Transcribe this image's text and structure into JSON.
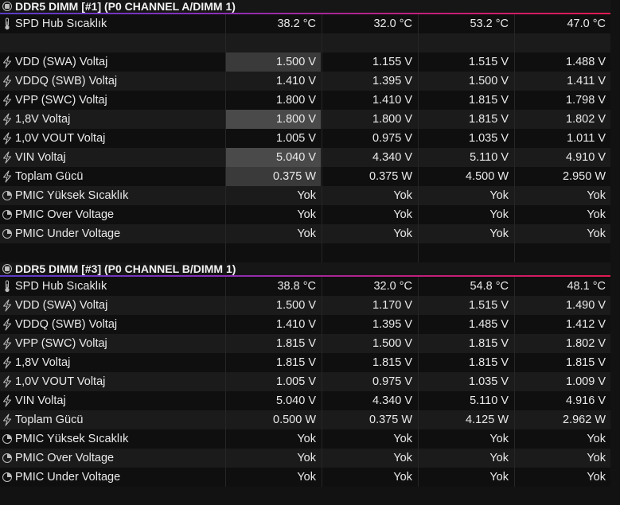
{
  "sections": [
    {
      "title": "DDR5 DIMM [#1] (P0 CHANNEL A/DIMM 1)",
      "rows": [
        {
          "icon": "thermometer-icon",
          "label": "SPD Hub Sıcaklık",
          "values": [
            "38.2 °C",
            "32.0 °C",
            "53.2 °C",
            "47.0 °C"
          ]
        },
        {
          "spacer": true
        },
        {
          "icon": "lightning-icon",
          "label": "VDD (SWA) Voltaj",
          "values": [
            "1.500 V",
            "1.155 V",
            "1.515 V",
            "1.488 V"
          ],
          "hl": "hl2"
        },
        {
          "icon": "lightning-icon",
          "label": "VDDQ (SWB) Voltaj",
          "values": [
            "1.410 V",
            "1.395 V",
            "1.500 V",
            "1.411 V"
          ]
        },
        {
          "icon": "lightning-icon",
          "label": "VPP (SWC) Voltaj",
          "values": [
            "1.800 V",
            "1.410 V",
            "1.815 V",
            "1.798 V"
          ]
        },
        {
          "icon": "lightning-icon",
          "label": "1,8V Voltaj",
          "values": [
            "1.800 V",
            "1.800 V",
            "1.815 V",
            "1.802 V"
          ],
          "hl": "hl1"
        },
        {
          "icon": "lightning-icon",
          "label": "1,0V VOUT Voltaj",
          "values": [
            "1.005 V",
            "0.975 V",
            "1.035 V",
            "1.011 V"
          ]
        },
        {
          "icon": "lightning-icon",
          "label": "VIN Voltaj",
          "values": [
            "5.040 V",
            "4.340 V",
            "5.110 V",
            "4.910 V"
          ],
          "hl": "hl1"
        },
        {
          "icon": "lightning-icon",
          "label": "Toplam Gücü",
          "values": [
            "0.375 W",
            "0.375 W",
            "4.500 W",
            "2.950 W"
          ],
          "hl": "hl2"
        },
        {
          "icon": "clock-icon",
          "label": "PMIC Yüksek Sıcaklık",
          "values": [
            "Yok",
            "Yok",
            "Yok",
            "Yok"
          ]
        },
        {
          "icon": "clock-icon",
          "label": "PMIC Over Voltage",
          "values": [
            "Yok",
            "Yok",
            "Yok",
            "Yok"
          ]
        },
        {
          "icon": "clock-icon",
          "label": "PMIC Under Voltage",
          "values": [
            "Yok",
            "Yok",
            "Yok",
            "Yok"
          ]
        },
        {
          "spacer": true
        }
      ]
    },
    {
      "title": "DDR5 DIMM [#3] (P0 CHANNEL B/DIMM 1)",
      "rows": [
        {
          "icon": "thermometer-icon",
          "label": "SPD Hub Sıcaklık",
          "values": [
            "38.8 °C",
            "32.0 °C",
            "54.8 °C",
            "48.1 °C"
          ]
        },
        {
          "icon": "lightning-icon",
          "label": "VDD (SWA) Voltaj",
          "values": [
            "1.500 V",
            "1.170 V",
            "1.515 V",
            "1.490 V"
          ]
        },
        {
          "icon": "lightning-icon",
          "label": "VDDQ (SWB) Voltaj",
          "values": [
            "1.410 V",
            "1.395 V",
            "1.485 V",
            "1.412 V"
          ]
        },
        {
          "icon": "lightning-icon",
          "label": "VPP (SWC) Voltaj",
          "values": [
            "1.815 V",
            "1.500 V",
            "1.815 V",
            "1.802 V"
          ]
        },
        {
          "icon": "lightning-icon",
          "label": "1,8V Voltaj",
          "values": [
            "1.815 V",
            "1.815 V",
            "1.815 V",
            "1.815 V"
          ]
        },
        {
          "icon": "lightning-icon",
          "label": "1,0V VOUT Voltaj",
          "values": [
            "1.005 V",
            "0.975 V",
            "1.035 V",
            "1.009 V"
          ]
        },
        {
          "icon": "lightning-icon",
          "label": "VIN Voltaj",
          "values": [
            "5.040 V",
            "4.340 V",
            "5.110 V",
            "4.916 V"
          ]
        },
        {
          "icon": "lightning-icon",
          "label": "Toplam Gücü",
          "values": [
            "0.500 W",
            "0.375 W",
            "4.125 W",
            "2.962 W"
          ]
        },
        {
          "icon": "clock-icon",
          "label": "PMIC Yüksek Sıcaklık",
          "values": [
            "Yok",
            "Yok",
            "Yok",
            "Yok"
          ]
        },
        {
          "icon": "clock-icon",
          "label": "PMIC Over Voltage",
          "values": [
            "Yok",
            "Yok",
            "Yok",
            "Yok"
          ]
        },
        {
          "icon": "clock-icon",
          "label": "PMIC Under Voltage",
          "values": [
            "Yok",
            "Yok",
            "Yok",
            "Yok"
          ]
        }
      ]
    }
  ],
  "colors": {
    "accent_start": "#5a3cc8",
    "accent_end": "#e01a52",
    "highlight_cell": "#4a4a4a"
  }
}
